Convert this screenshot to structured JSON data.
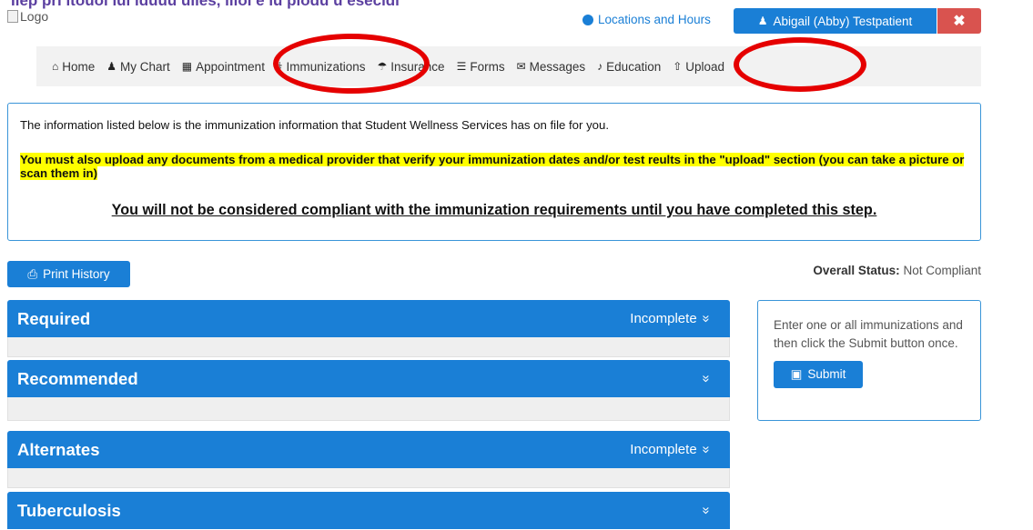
{
  "header": {
    "top_cut_text": "Ilep pri itouoi iui iduuu ulies, ilioi e iu plodu u esecidi",
    "logo_alt": "Logo",
    "locations_label": "Locations and Hours",
    "user_label": "Abigail (Abby) Testpatient",
    "close_label": "✖"
  },
  "nav": {
    "items": [
      {
        "icon": "home-icon",
        "glyph": "⌂",
        "label": "Home"
      },
      {
        "icon": "user-icon",
        "glyph": "♟",
        "label": "My Chart"
      },
      {
        "icon": "calendar-icon",
        "glyph": "▦",
        "label": "Appointment"
      },
      {
        "icon": "stethoscope-icon",
        "glyph": "⚕",
        "label": "Immunizations"
      },
      {
        "icon": "umbrella-icon",
        "glyph": "☂",
        "label": "Insurance"
      },
      {
        "icon": "list-icon",
        "glyph": "☰",
        "label": "Forms"
      },
      {
        "icon": "envelope-icon",
        "glyph": "✉",
        "label": "Messages"
      },
      {
        "icon": "bell-icon",
        "glyph": "♪",
        "label": "Education"
      },
      {
        "icon": "upload-icon",
        "glyph": "⇧",
        "label": "Upload"
      }
    ]
  },
  "info": {
    "line1": "The information listed below is the immunization information that Student Wellness Services has on file for you.",
    "warning": "You must also upload any documents from a medical provider that verify your immunization dates and/or test reults in the \"upload\" section (you can take a picture or scan them in)",
    "compliance": "You will not be considered compliant with the immunization requirements until you have completed this step."
  },
  "actions": {
    "print_label": "Print History",
    "status_label": "Overall Status:",
    "status_value": "Not Compliant"
  },
  "sections": [
    {
      "title": "Required",
      "status": "Incomplete"
    },
    {
      "title": "Recommended",
      "status": ""
    },
    {
      "title": "Alternates",
      "status": "Incomplete"
    },
    {
      "title": "Tuberculosis",
      "status": ""
    }
  ],
  "side_panel": {
    "text": "Enter one or all immunizations and then click the Submit button once.",
    "submit_label": "Submit"
  },
  "colors": {
    "primary": "#1a7fd6",
    "danger": "#d9534f",
    "highlight": "#ffff00",
    "annotation": "#e50000"
  }
}
